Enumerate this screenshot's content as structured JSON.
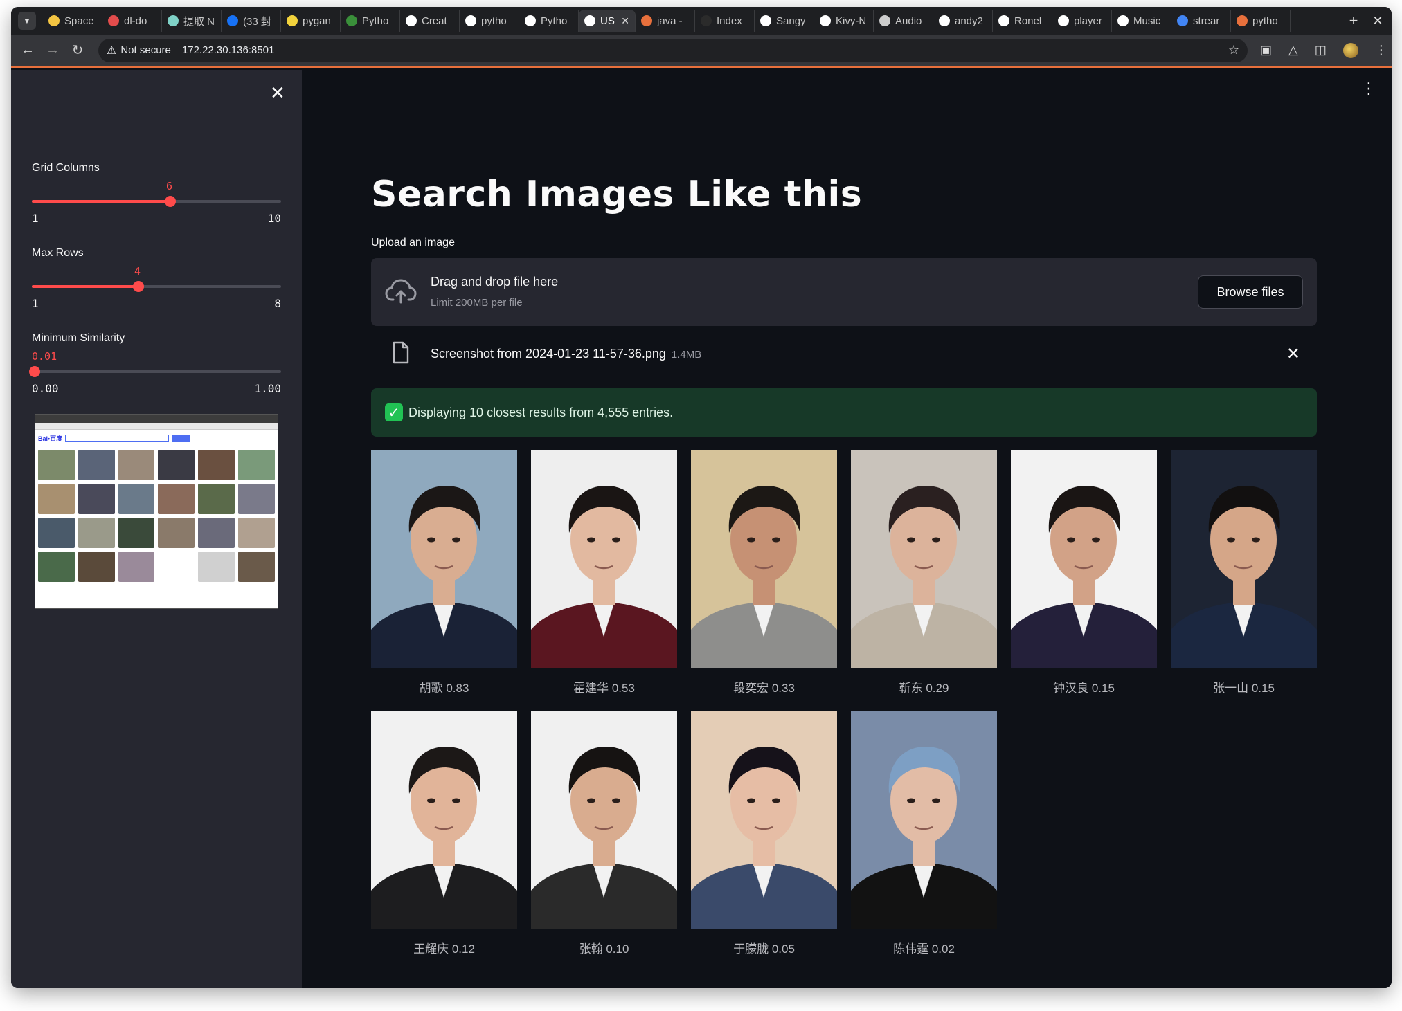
{
  "browser": {
    "tabs": [
      {
        "title": "Space",
        "color": "#f4c542"
      },
      {
        "title": "dl-do",
        "color": "#e34c4c"
      },
      {
        "title": "提取 N",
        "color": "#7fd1c7"
      },
      {
        "title": "(33 封",
        "color": "#1772f6"
      },
      {
        "title": "pygan",
        "color": "#f2d23c"
      },
      {
        "title": "Pytho",
        "color": "#3a8f3a"
      },
      {
        "title": "Creat",
        "color": "#ffffff"
      },
      {
        "title": "pytho",
        "color": "#ffffff"
      },
      {
        "title": "Pytho",
        "color": "#ffffff"
      },
      {
        "title": "US",
        "color": "#ffffff"
      },
      {
        "title": "java -",
        "color": "#e8703c"
      },
      {
        "title": "Index",
        "color": "#2b2b2b"
      },
      {
        "title": "Sangy",
        "color": "#ffffff"
      },
      {
        "title": "Kivy-N",
        "color": "#ffffff"
      },
      {
        "title": "Audio",
        "color": "#cccccc"
      },
      {
        "title": "andy2",
        "color": "#ffffff"
      },
      {
        "title": "Ronel",
        "color": "#ffffff"
      },
      {
        "title": "player",
        "color": "#ffffff"
      },
      {
        "title": "Music",
        "color": "#ffffff"
      },
      {
        "title": "strear",
        "color": "#4285f4"
      },
      {
        "title": "pytho",
        "color": "#e8703c"
      }
    ],
    "active_tab_index": 9,
    "security_label": "Not secure",
    "url": "172.22.30.136:8501"
  },
  "sidebar": {
    "sliders": [
      {
        "label": "Grid Columns",
        "value": "6",
        "min": "1",
        "max": "10",
        "fraction": 0.5556
      },
      {
        "label": "Max Rows",
        "value": "4",
        "min": "1",
        "max": "8",
        "fraction": 0.4286
      },
      {
        "label": "Minimum Similarity",
        "value": "0.01",
        "min": "0.00",
        "max": "1.00",
        "fraction": 0.01
      }
    ]
  },
  "main": {
    "title": "Search Images Like this",
    "upload_label": "Upload an image",
    "dropzone_title": "Drag and drop file here",
    "dropzone_limit": "Limit 200MB per file",
    "browse_button": "Browse files",
    "file_name": "Screenshot from 2024-01-23 11-57-36.png",
    "file_size": "1.4MB",
    "alert_message": "Displaying 10 closest results from 4,555 entries.",
    "results": [
      {
        "caption": "胡歌 0.83",
        "bg": "#8fa9be",
        "suit": "#1a2236",
        "skin": "#d9ad91",
        "hair": "#1b1716"
      },
      {
        "caption": "霍建华 0.53",
        "bg": "#eeeeee",
        "suit": "#5a1620",
        "skin": "#e2b9a0",
        "hair": "#1a1514"
      },
      {
        "caption": "段奕宏 0.33",
        "bg": "#d6c39a",
        "suit": "#8e8e8c",
        "skin": "#c69174",
        "hair": "#1c1815"
      },
      {
        "caption": "靳东 0.29",
        "bg": "#c9c3bb",
        "suit": "#bdb3a4",
        "skin": "#dcb39b",
        "hair": "#2a2020"
      },
      {
        "caption": "钟汉良 0.15",
        "bg": "#f2f2f2",
        "suit": "#24203a",
        "skin": "#d2a287",
        "hair": "#1a1514"
      },
      {
        "caption": "张一山 0.15",
        "bg": "#1d2433",
        "suit": "#1b2740",
        "skin": "#d5a688",
        "hair": "#121010"
      },
      {
        "caption": "王耀庆 0.12",
        "bg": "#f1f1f1",
        "suit": "#1d1d1f",
        "skin": "#e1b499",
        "hair": "#1c1817"
      },
      {
        "caption": "张翰 0.10",
        "bg": "#f0f0f0",
        "suit": "#2a2a2a",
        "skin": "#d9ac8f",
        "hair": "#161312"
      },
      {
        "caption": "于朦胧 0.05",
        "bg": "#e4cdb6",
        "suit": "#3a4a6a",
        "skin": "#e6bda5",
        "hair": "#16121a"
      },
      {
        "caption": "陈伟霆 0.02",
        "bg": "#7a8ca8",
        "suit": "#121212",
        "skin": "#e2bca6",
        "hair": "#7d9fc4"
      }
    ]
  }
}
